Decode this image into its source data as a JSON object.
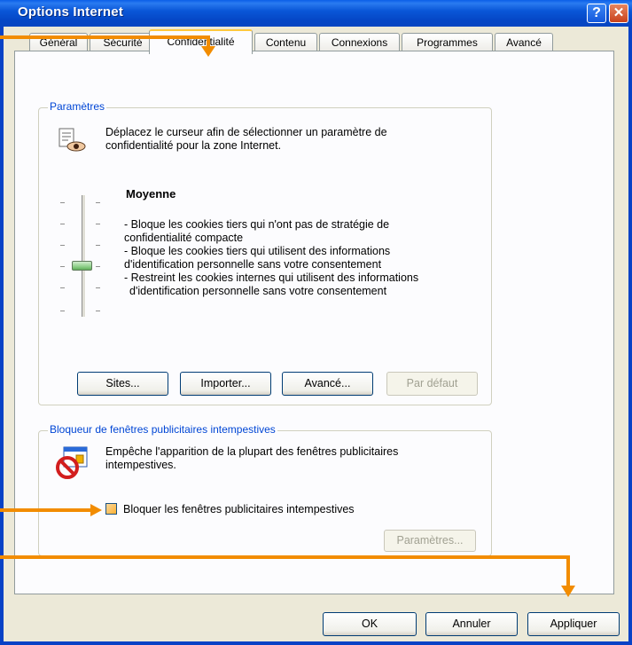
{
  "window": {
    "title": "Options Internet"
  },
  "tabs": [
    {
      "label": "Général"
    },
    {
      "label": "Sécurité"
    },
    {
      "label": "Confidentialité",
      "active": true
    },
    {
      "label": "Contenu"
    },
    {
      "label": "Connexions"
    },
    {
      "label": "Programmes"
    },
    {
      "label": "Avancé"
    }
  ],
  "settings_group": {
    "title": "Paramètres",
    "description_line1": "Déplacez le curseur afin de sélectionner un paramètre de",
    "description_line2": "confidentialité pour la zone Internet.",
    "level_title": "Moyenne",
    "level_lines": [
      "- Bloque les cookies tiers qui n'ont pas de stratégie de",
      "confidentialité compacte",
      "- Bloque les cookies tiers qui utilisent des informations",
      "d'identification personnelle sans votre consentement",
      "- Restreint les cookies internes qui utilisent des informations",
      "  d'identification personnelle sans votre consentement"
    ],
    "buttons": {
      "sites": "Sites...",
      "import": "Importer...",
      "advanced": "Avancé...",
      "default": "Par défaut"
    }
  },
  "popup_group": {
    "title": "Bloqueur de fenêtres publicitaires intempestives",
    "description_line1": "Empêche l'apparition de la plupart des fenêtres publicitaires",
    "description_line2": "intempestives.",
    "checkbox_label": "Bloquer les fenêtres publicitaires intempestives",
    "checkbox_checked": false,
    "settings_button": "Paramètres..."
  },
  "dialog_buttons": {
    "ok": "OK",
    "cancel": "Annuler",
    "apply": "Appliquer"
  },
  "colors": {
    "annotation_arrow": "#f28c00",
    "titlebar": "#0a57d8",
    "group_title": "#0046d5"
  },
  "slider": {
    "levels": 6,
    "selected_level": 3
  }
}
